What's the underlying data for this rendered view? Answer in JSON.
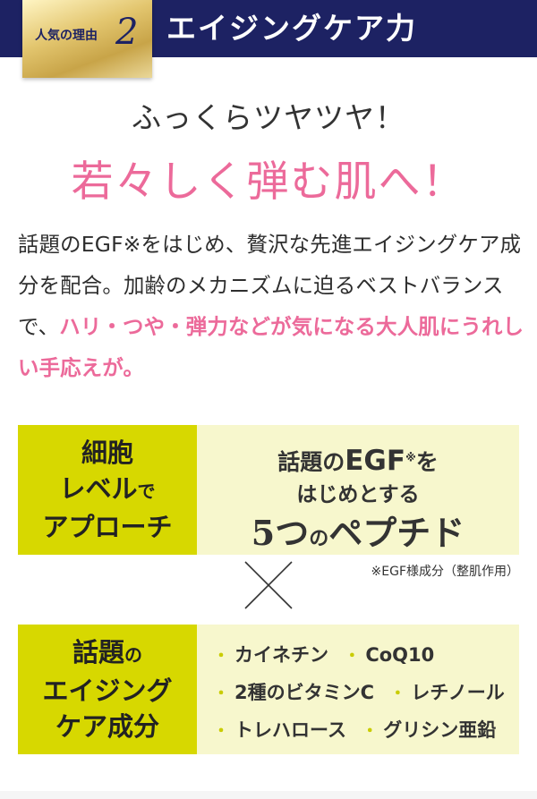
{
  "header": {
    "tab_label": "人気の理由",
    "tab_number": "2",
    "title": "エイジングケア力"
  },
  "subhead": "ふっくらツヤツヤ！",
  "headline": "若々しく弾む肌へ！",
  "body": {
    "text_plain": "話題のEGF※をはじめ、贅沢な先進エイジングケア成分を配合。加齢のメカニズムに迫るベストバランスで、",
    "text_highlight": "ハリ・つや・弾力などが気になる大人肌にうれしい手応えが。"
  },
  "panel1": {
    "left_line1": "細胞",
    "left_line2a": "レベル",
    "left_line2b": "で",
    "left_line3": "アプローチ",
    "right_line1a": "話題の",
    "right_line1b": "EGF",
    "right_line1_sup": "※",
    "right_line1c": "を",
    "right_line2": "はじめとする",
    "right_line3a": "5つ",
    "right_line3b": "の",
    "right_line3c": "ペプチド"
  },
  "note": "※EGF様成分（整肌作用）",
  "panel2": {
    "left_line1a": "話題",
    "left_line1b": "の",
    "left_line2": "エイジング",
    "left_line3": "ケア成分",
    "ingredients": [
      "カイネチン",
      "CoQ10",
      "2種のビタミンC",
      "レチノール",
      "トレハロース",
      "グリシン亜鉛"
    ],
    "bullet": "・"
  },
  "colors": {
    "navy": "#1d2263",
    "pink": "#ec6a9a",
    "lime": "#d7d800",
    "cream": "#f7f7cd"
  }
}
